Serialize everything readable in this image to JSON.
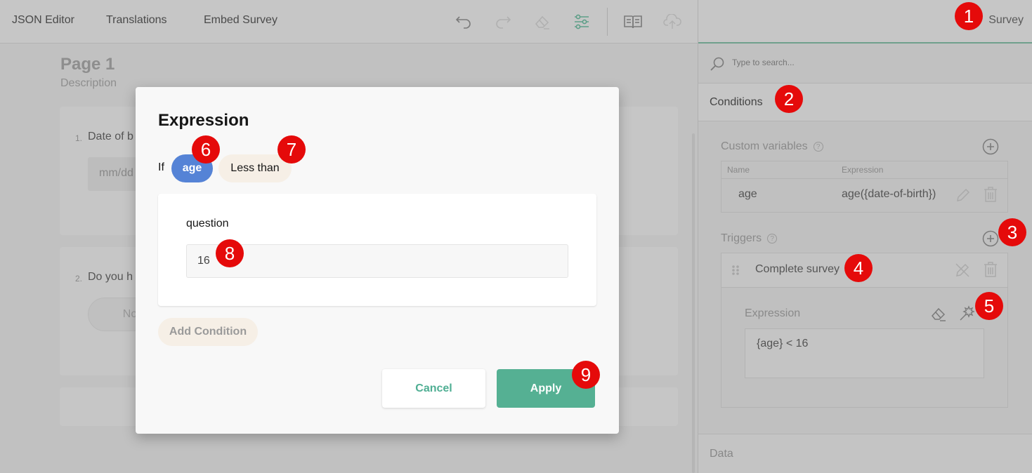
{
  "topbar": {
    "tabs": [
      "JSON Editor",
      "Translations",
      "Embed Survey"
    ],
    "icons": [
      "undo-icon",
      "redo-icon",
      "eraser-icon",
      "settings-sliders-icon",
      "book-icon",
      "cloud-upload-icon"
    ]
  },
  "page": {
    "title": "Page 1",
    "description": "Description",
    "questions": [
      {
        "number": "1.",
        "title": "Date of b",
        "input_placeholder": "mm/dd"
      },
      {
        "number": "2.",
        "title": "Do you h",
        "button_label": "No"
      }
    ]
  },
  "right_panel": {
    "tab_label": "Survey",
    "search_placeholder": "Type to search...",
    "section_title": "Conditions",
    "custom_variables": {
      "label": "Custom variables",
      "help": "?",
      "columns": [
        "Name",
        "Expression"
      ],
      "rows": [
        {
          "name": "age",
          "expression": "age({date-of-birth})"
        }
      ]
    },
    "triggers": {
      "label": "Triggers",
      "help": "?",
      "items": [
        {
          "label": "Complete survey",
          "expression_label": "Expression",
          "expression": "{age} < 16"
        }
      ]
    },
    "data_section": "Data"
  },
  "modal": {
    "title": "Expression",
    "if_label": "If",
    "variable_chip": "age",
    "operator_chip": "Less than",
    "question_label": "question",
    "question_value": "16",
    "add_condition": "Add Condition",
    "cancel": "Cancel",
    "apply": "Apply"
  },
  "badges": [
    "1",
    "2",
    "3",
    "4",
    "5",
    "6",
    "7",
    "8",
    "9"
  ],
  "colors": {
    "accent": "#55b093",
    "chip_variable": "#5583d6",
    "chip_operator": "#f6efe6",
    "badge": "#e50a0a"
  }
}
